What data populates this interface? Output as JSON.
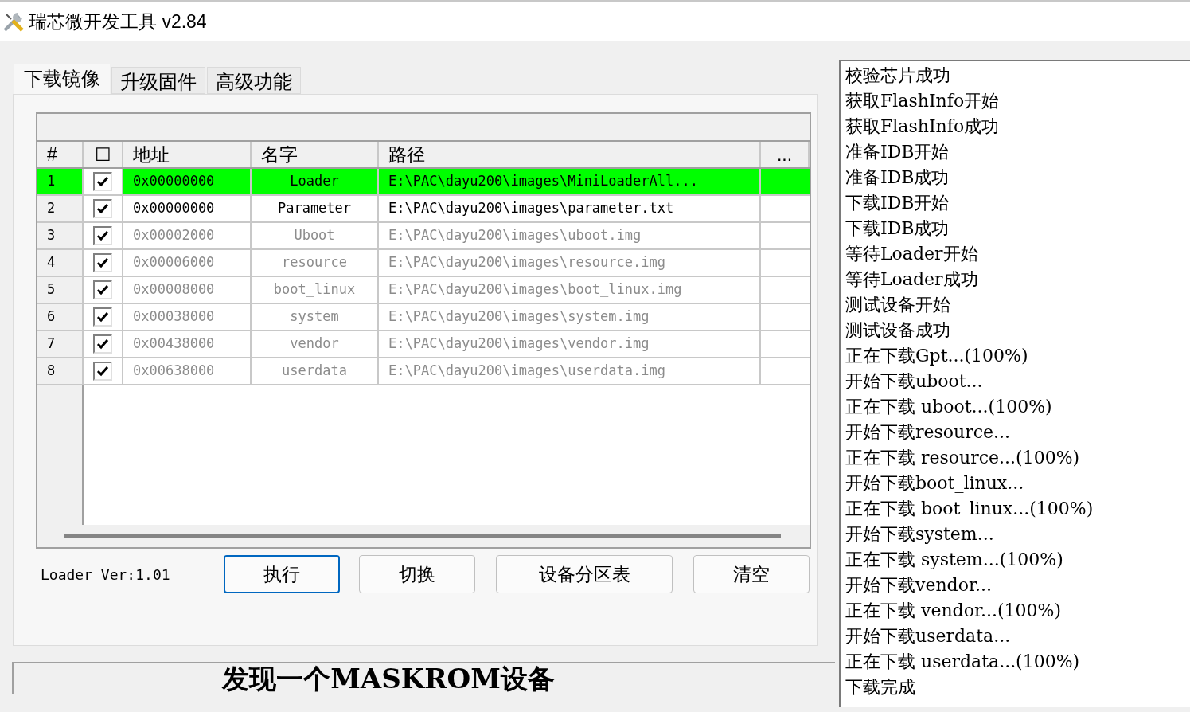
{
  "window": {
    "title": "瑞芯微开发工具 v2.84"
  },
  "tabs": [
    {
      "label": "下载镜像",
      "selected": true
    },
    {
      "label": "升级固件",
      "selected": false
    },
    {
      "label": "高级功能",
      "selected": false
    }
  ],
  "table": {
    "columns": [
      "#",
      "☐",
      "地址",
      "名字",
      "路径",
      "..."
    ],
    "rows": [
      {
        "index": "1",
        "checked": true,
        "address": "0x00000000",
        "name": "Loader",
        "path": "E:\\PAC\\dayu200\\images\\MiniLoaderAll...",
        "selected": true,
        "disabled": false
      },
      {
        "index": "2",
        "checked": true,
        "address": "0x00000000",
        "name": "Parameter",
        "path": "E:\\PAC\\dayu200\\images\\parameter.txt",
        "selected": false,
        "disabled": false
      },
      {
        "index": "3",
        "checked": true,
        "address": "0x00002000",
        "name": "Uboot",
        "path": "E:\\PAC\\dayu200\\images\\uboot.img",
        "selected": false,
        "disabled": true
      },
      {
        "index": "4",
        "checked": true,
        "address": "0x00006000",
        "name": "resource",
        "path": "E:\\PAC\\dayu200\\images\\resource.img",
        "selected": false,
        "disabled": true
      },
      {
        "index": "5",
        "checked": true,
        "address": "0x00008000",
        "name": "boot_linux",
        "path": "E:\\PAC\\dayu200\\images\\boot_linux.img",
        "selected": false,
        "disabled": true
      },
      {
        "index": "6",
        "checked": true,
        "address": "0x00038000",
        "name": "system",
        "path": "E:\\PAC\\dayu200\\images\\system.img",
        "selected": false,
        "disabled": true
      },
      {
        "index": "7",
        "checked": true,
        "address": "0x00438000",
        "name": "vendor",
        "path": "E:\\PAC\\dayu200\\images\\vendor.img",
        "selected": false,
        "disabled": true
      },
      {
        "index": "8",
        "checked": true,
        "address": "0x00638000",
        "name": "userdata",
        "path": "E:\\PAC\\dayu200\\images\\userdata.img",
        "selected": false,
        "disabled": true
      }
    ]
  },
  "loader_version": "Loader Ver:1.01",
  "buttons": [
    {
      "label": "执行",
      "focused": true
    },
    {
      "label": "切换",
      "focused": false
    },
    {
      "label": "设备分区表",
      "focused": false
    },
    {
      "label": "清空",
      "focused": false
    }
  ],
  "status_bar": "发现一个MASKROM设备",
  "log": [
    "校验芯片成功",
    "获取FlashInfo开始",
    "获取FlashInfo成功",
    "准备IDB开始",
    "准备IDB成功",
    "下载IDB开始",
    "下载IDB成功",
    "等待Loader开始",
    "等待Loader成功",
    "测试设备开始",
    "测试设备成功",
    "正在下载Gpt...(100%)",
    "开始下载uboot...",
    "正在下载 uboot...(100%)",
    "开始下载resource...",
    "正在下载 resource...(100%)",
    "开始下载boot_linux...",
    "正在下载 boot_linux...(100%)",
    "开始下载system...",
    "正在下载 system...(100%)",
    "开始下载vendor...",
    "正在下载 vendor...(100%)",
    "开始下载userdata...",
    "正在下载 userdata...(100%)",
    "下载完成"
  ]
}
